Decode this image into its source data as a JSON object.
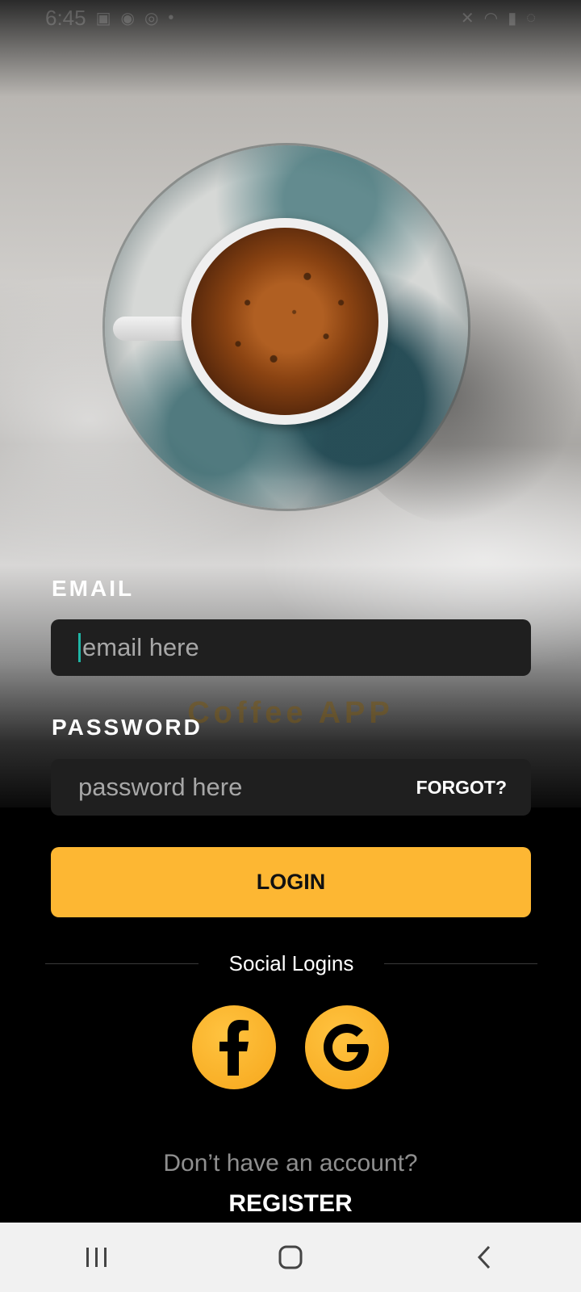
{
  "status_bar": {
    "time": "6:45"
  },
  "watermark": "Coffee APP",
  "email": {
    "label": "EMAIL",
    "placeholder": "email here"
  },
  "password": {
    "label": "PASSWORD",
    "placeholder": "password here",
    "forgot_label": "FORGOT?"
  },
  "login_button": "LOGIN",
  "social": {
    "title": "Social Logins",
    "providers": [
      {
        "name": "facebook",
        "icon": "facebook-icon"
      },
      {
        "name": "google",
        "icon": "google-icon"
      }
    ]
  },
  "footer": {
    "prompt": "Don’t have an account?",
    "register_label": "REGISTER"
  },
  "colors": {
    "accent": "#fdb733",
    "input_bg": "#1f1f1f",
    "caret": "#1fb5a5",
    "background": "#000000"
  },
  "nav": {
    "icons": [
      "recent-apps-icon",
      "home-icon",
      "back-icon"
    ]
  }
}
